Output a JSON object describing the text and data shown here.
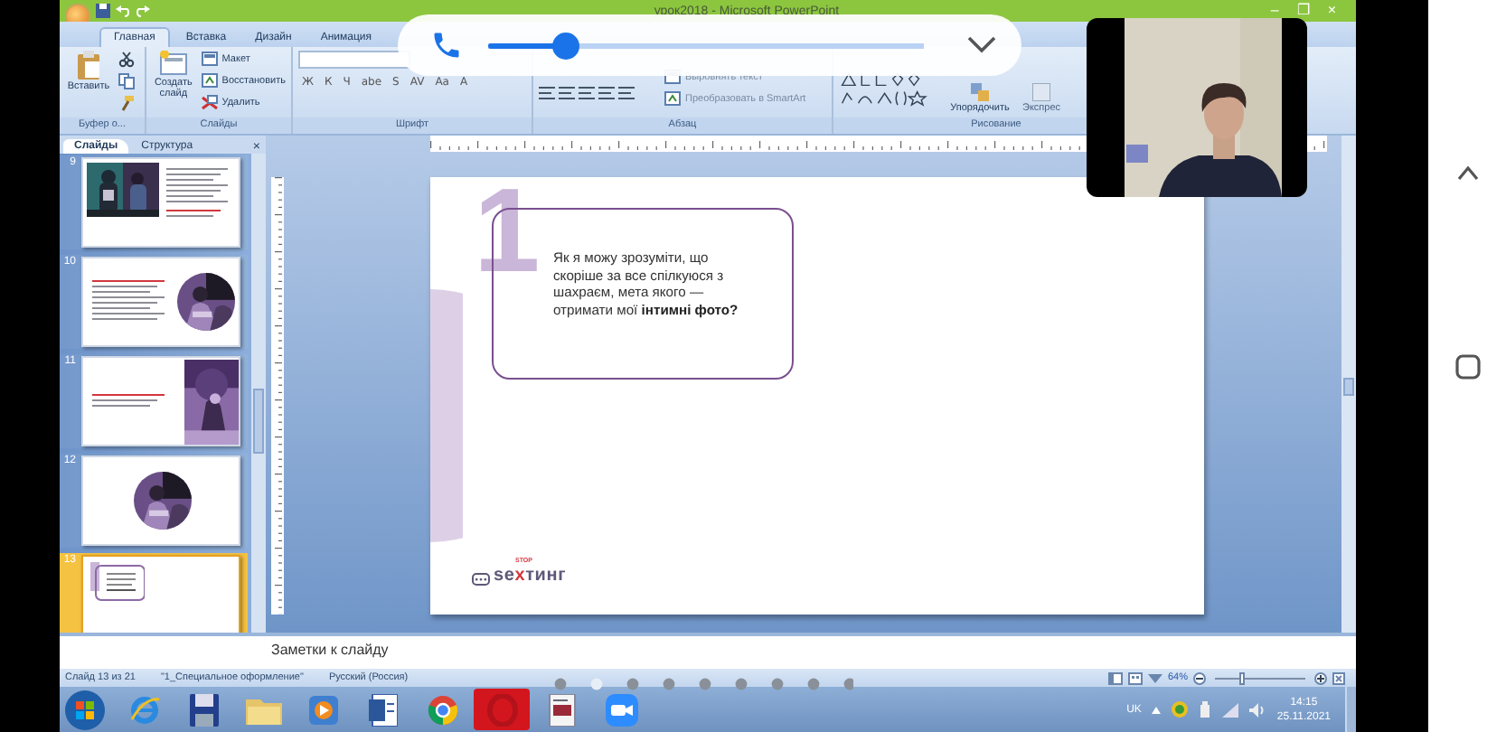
{
  "window": {
    "title": "урок2018 - Microsoft PowerPoint",
    "controls": [
      "–",
      "❐",
      "×"
    ]
  },
  "ribbon_tabs": [
    {
      "label": "Главная",
      "selected": true
    },
    {
      "label": "Вставка",
      "selected": false
    },
    {
      "label": "Дизайн",
      "selected": false
    },
    {
      "label": "Анимация",
      "selected": false
    }
  ],
  "ribbon": {
    "clipboard": {
      "label": "Буфер о...",
      "paste": "Вставить"
    },
    "slides": {
      "label": "Слайды",
      "new_slide": "Создать слайд",
      "layout": "Макет",
      "reset": "Восстановить",
      "delete": "Удалить"
    },
    "font": {
      "label": "Шрифт",
      "format_buttons": [
        "Ж",
        "К",
        "Ч",
        "abe",
        "S",
        "AV",
        "Aa",
        "A"
      ]
    },
    "paragraph": {
      "label": "Абзац",
      "align_text": "Выровнять текст",
      "smartart": "Преобразовать в SmartArt"
    },
    "drawing": {
      "label": "Рисование",
      "arrange": "Упорядочить",
      "quick_styles": "Экспрес"
    }
  },
  "slide_panel": {
    "tabs": [
      {
        "label": "Слайды",
        "selected": true
      },
      {
        "label": "Структура",
        "selected": false
      }
    ],
    "close": "×",
    "slides": [
      {
        "number": "9",
        "selected": false,
        "kind": "photo-left"
      },
      {
        "number": "10",
        "selected": false,
        "kind": "circle-right"
      },
      {
        "number": "11",
        "selected": false,
        "kind": "photo-right"
      },
      {
        "number": "12",
        "selected": false,
        "kind": "circle-center"
      },
      {
        "number": "13",
        "selected": true,
        "kind": "question"
      }
    ]
  },
  "slide": {
    "number": "1",
    "question": "Як я можу зрозуміти, що скоріше за все спілкуюся з шахраєм, мета якого — отримати мої **інтимні фото?**",
    "logo": {
      "small": "STOP",
      "word_start": "se",
      "word_mark": "x",
      "word_end": "тинг"
    }
  },
  "notes": {
    "placeholder": "Заметки к слайду"
  },
  "status_bar": {
    "slide": "Слайд 13 из 21",
    "theme": "\"1_Специальное оформление\"",
    "language": "Русский (Россия)",
    "zoom": "64%",
    "zoom_level": {
      "level": 0.3
    }
  },
  "taskbar": {
    "apps": [
      {
        "kind": "ie"
      },
      {
        "kind": "floppy"
      },
      {
        "kind": "folder"
      },
      {
        "kind": "media"
      },
      {
        "kind": "writer"
      },
      {
        "kind": "chrome"
      },
      {
        "kind": "opera"
      },
      {
        "kind": "document"
      },
      {
        "kind": "camera"
      }
    ],
    "language": "UK",
    "time": "14:15",
    "date": "25.11.2021"
  },
  "call_bar": {
    "level": 0.18
  }
}
